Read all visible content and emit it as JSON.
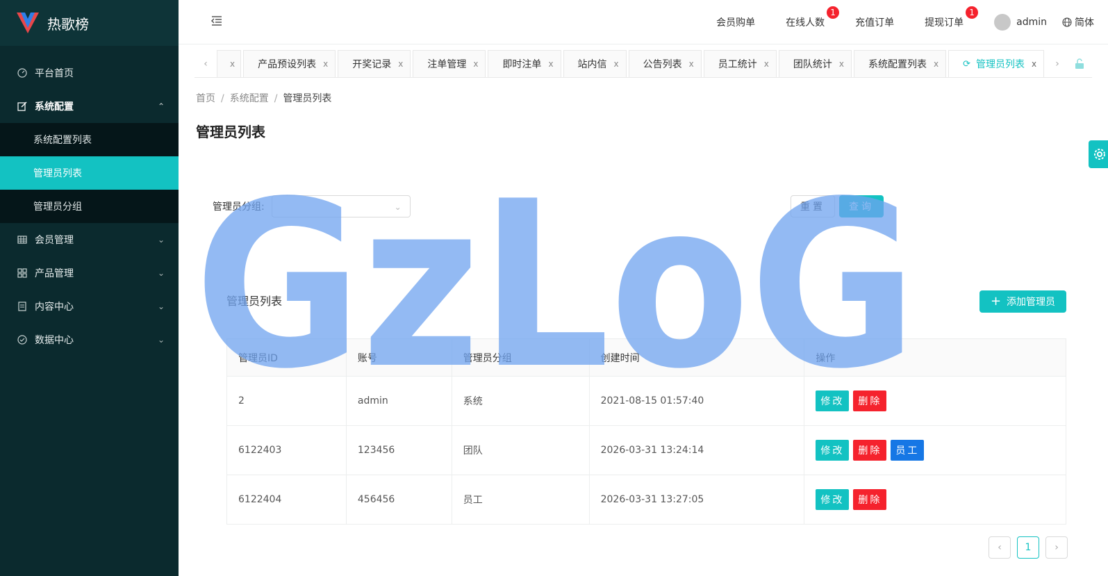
{
  "app": {
    "title": "热歌榜"
  },
  "sidebar": {
    "items": [
      {
        "label": "平台首页",
        "icon": "dashboard-icon"
      },
      {
        "label": "系统配置",
        "icon": "edit-icon",
        "open": true,
        "children": [
          "系统配置列表",
          "管理员列表",
          "管理员分组"
        ],
        "active_child": "管理员列表"
      },
      {
        "label": "会员管理",
        "icon": "table-icon"
      },
      {
        "label": "产品管理",
        "icon": "appstore-icon"
      },
      {
        "label": "内容中心",
        "icon": "profile-icon"
      },
      {
        "label": "数据中心",
        "icon": "check-circle-icon"
      }
    ]
  },
  "header": {
    "links": [
      {
        "label": "会员购单"
      },
      {
        "label": "在线人数",
        "badge": "1"
      },
      {
        "label": "充值订单"
      },
      {
        "label": "提现订单",
        "badge": "1"
      }
    ],
    "user": "admin",
    "language": "简体"
  },
  "tabs": {
    "items": [
      "产品预设列表",
      "开奖记录",
      "注单管理",
      "即时注单",
      "站内信",
      "公告列表",
      "员工统计",
      "团队统计",
      "系统配置列表",
      "管理员列表"
    ],
    "active": "管理员列表",
    "close_glyph": "x"
  },
  "breadcrumb": [
    "首页",
    "系统配置",
    "管理员列表"
  ],
  "page_title": "管理员列表",
  "filter": {
    "label": "管理员分组:",
    "reset_label": "重置",
    "search_label": "查询"
  },
  "table": {
    "title": "管理员列表",
    "add_label": "添加管理员",
    "columns": [
      "管理员ID",
      "账号",
      "管理员分组",
      "创建时间",
      "操作"
    ],
    "rows": [
      {
        "id": "2",
        "account": "admin",
        "group": "系统",
        "created": "2021-08-15 01:57:40",
        "actions": [
          "修改",
          "删除"
        ]
      },
      {
        "id": "6122403",
        "account": "123456",
        "group": "团队",
        "created": "2026-03-31 13:24:14",
        "actions": [
          "修改",
          "删除",
          "员工"
        ]
      },
      {
        "id": "6122404",
        "account": "456456",
        "group": "员工",
        "created": "2026-03-31 13:27:05",
        "actions": [
          "修改",
          "删除"
        ]
      }
    ]
  },
  "pagination": {
    "current": "1"
  },
  "watermark": {
    "text": "GzLoG",
    "color": "#6fa3ef"
  },
  "colors": {
    "accent": "#13c2c2",
    "danger": "#f5222d",
    "primary": "#1677e5",
    "sidebar_bg": "#0b2a2e"
  }
}
